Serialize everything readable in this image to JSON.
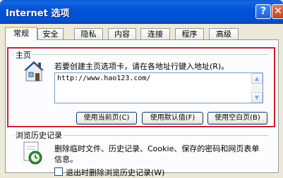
{
  "window": {
    "title": "Internet 选项",
    "help_label": "?",
    "close_label": "✕"
  },
  "tabs": [
    {
      "label": "常规",
      "active": true
    },
    {
      "label": "安全",
      "active": false
    },
    {
      "label": "隐私",
      "active": false
    },
    {
      "label": "内容",
      "active": false
    },
    {
      "label": "连接",
      "active": false
    },
    {
      "label": "程序",
      "active": false
    },
    {
      "label": "高级",
      "active": false
    }
  ],
  "home": {
    "group_label": "主页",
    "description": "若要创建主页选项卡，请在各地址行键入地址(R)。",
    "url": "http://www.hao123.com/",
    "icon": "home-page-icon",
    "buttons": {
      "use_current": "使用当前页(C)",
      "use_default": "使用默认值(F)",
      "use_blank": "使用空白页(B)"
    }
  },
  "history": {
    "group_label": "浏览历史记录",
    "description": "删除临时文件、历史记录、Cookie、保存的密码和网页表单信息。",
    "checkbox_label": "退出时删除浏览历史记录(W)",
    "checkbox_checked": false,
    "icon": "browsing-history-icon"
  },
  "colors": {
    "title_bar": "#0054E3",
    "highlight_outline": "#D21F2D",
    "dialog_bg": "#ECE9D8"
  }
}
